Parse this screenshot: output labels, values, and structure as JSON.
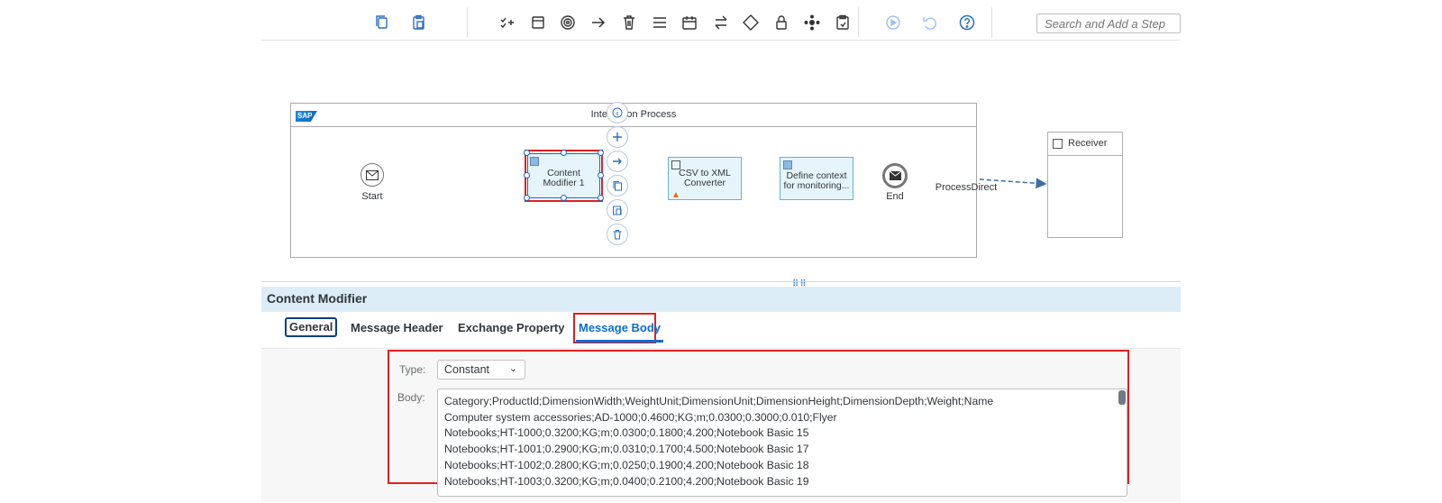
{
  "toolbar": {
    "search_placeholder": "Search and Add a Step",
    "buttons": [
      "copy-icon",
      "paste-icon",
      "check-add-icon",
      "window-icon",
      "target-icon",
      "arrow-right-icon",
      "trash-icon",
      "menu-icon",
      "calendar-icon",
      "swap-icon",
      "diamond-icon",
      "lock-icon",
      "cluster-icon",
      "clipboard-icon",
      "play-icon",
      "undo-icon",
      "help-icon"
    ]
  },
  "diagram": {
    "pool_title": "Integration Process",
    "logo": "SAP",
    "start_label": "Start",
    "end_label": "End",
    "steps": [
      {
        "label": "Content Modifier 1"
      },
      {
        "label": "CSV to XML Converter"
      },
      {
        "label": "Define context for monitoring..."
      }
    ],
    "connection_label": "ProcessDirect",
    "receiver_label": "Receiver"
  },
  "panel": {
    "title": "Content Modifier",
    "tabs": [
      "General",
      "Message Header",
      "Exchange Property",
      "Message Body"
    ],
    "active_tab": "Message Body",
    "type_label": "Type:",
    "type_value": "Constant",
    "body_label": "Body:",
    "body_lines": [
      "Category;ProductId;DimensionWidth;WeightUnit;DimensionUnit;DimensionHeight;DimensionDepth;Weight;Name",
      "Computer system accessories;AD-1000;0.4600;KG;m;0.0300;0.3000;0.010;Flyer",
      "Notebooks;HT-1000;0.3200;KG;m;0.0300;0.1800;4.200;Notebook Basic 15",
      "Notebooks;HT-1001;0.2900;KG;m;0.0310;0.1700;4.500;Notebook Basic 17",
      "Notebooks;HT-1002;0.2800;KG;m;0.0250;0.1900;4.200;Notebook Basic 18",
      "Notebooks;HT-1003;0.3200;KG;m;0.0400;0.2100;4.200;Notebook Basic 19"
    ]
  },
  "colors": {
    "accent": "#0a6ed1",
    "highlight": "#e02020",
    "panel_header": "#dcedf8"
  }
}
